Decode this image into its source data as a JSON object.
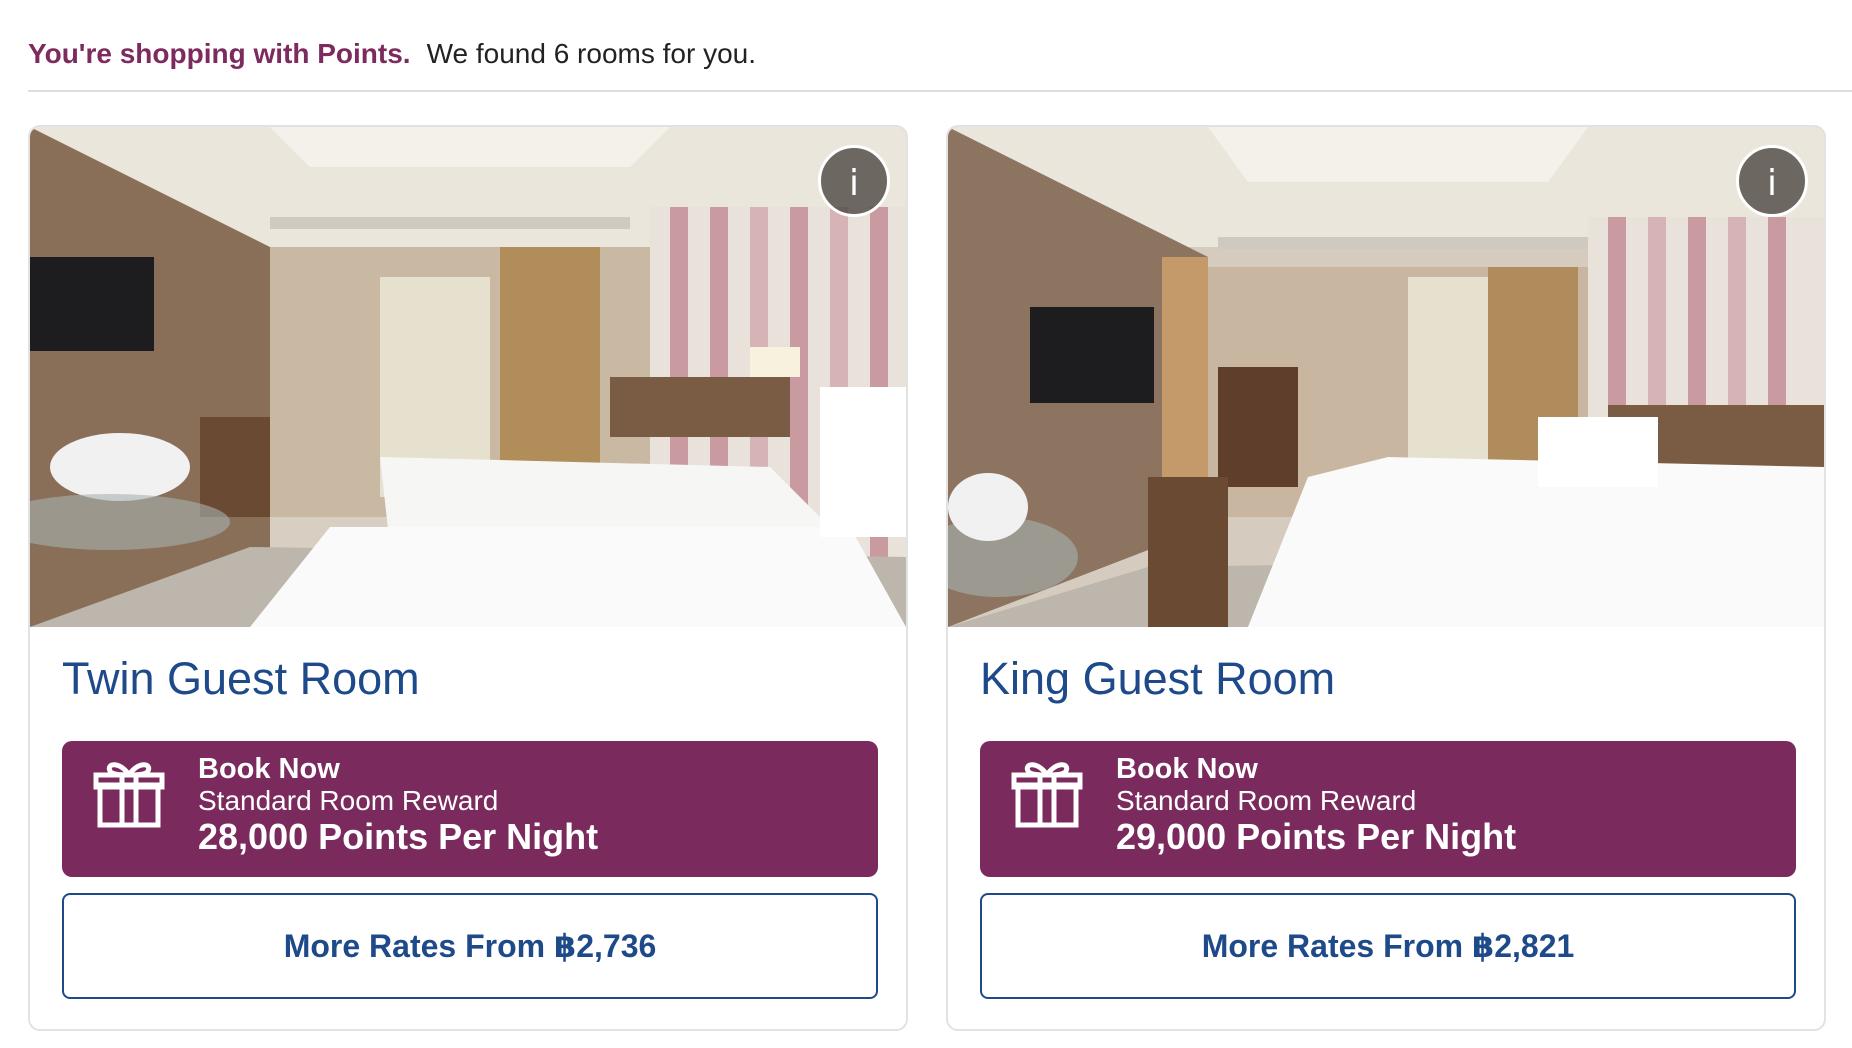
{
  "header": {
    "shopping_label": "You're shopping with Points.",
    "found_text": "We found 6 rooms for you."
  },
  "rooms": [
    {
      "title": "Twin Guest Room",
      "info_label": "i",
      "book_now": "Book Now",
      "reward_type": "Standard Room Reward",
      "points": "28,000 Points Per Night",
      "more_rates": "More Rates From ฿2,736"
    },
    {
      "title": "King Guest Room",
      "info_label": "i",
      "book_now": "Book Now",
      "reward_type": "Standard Room Reward",
      "points": "29,000 Points Per Night",
      "more_rates": "More Rates From ฿2,821"
    }
  ],
  "colors": {
    "brand_purple": "#7a2a5c",
    "shopping_label": "#7d2a5e",
    "link_blue": "#1e4a8a"
  },
  "icons": [
    "info-icon",
    "gift-icon"
  ]
}
